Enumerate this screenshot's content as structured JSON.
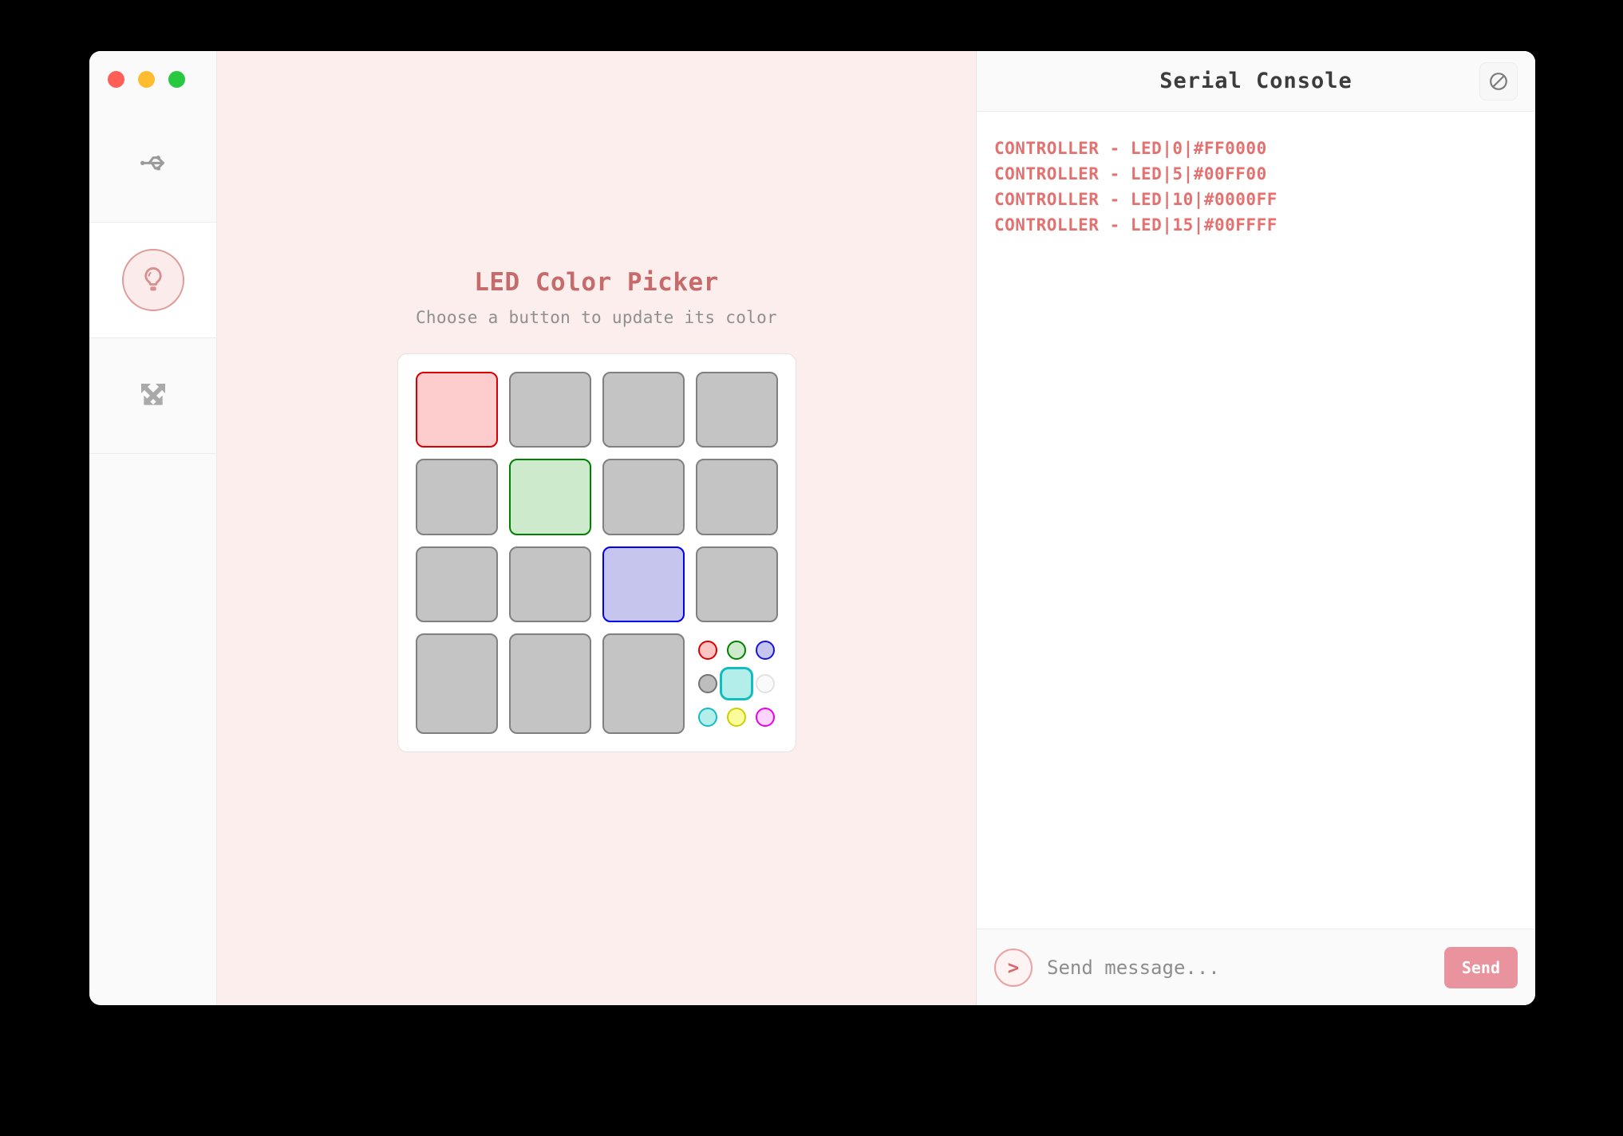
{
  "window": {
    "traffic_lights": [
      {
        "name": "close",
        "color": "#ff5f57"
      },
      {
        "name": "minimize",
        "color": "#febc2e"
      },
      {
        "name": "maximize",
        "color": "#28c840"
      }
    ]
  },
  "sidebar": {
    "items": [
      {
        "icon": "usb-icon",
        "active": false
      },
      {
        "icon": "lightbulb-icon",
        "active": true
      },
      {
        "icon": "expand-arrows-icon",
        "active": false
      }
    ]
  },
  "main": {
    "title": "LED Color Picker",
    "subtitle": "Choose a button to update its color",
    "title_color": "#c66b6b",
    "background": "#fbeeec",
    "led_grid": {
      "rows": 4,
      "cols": 4,
      "default_fill": "#c4c4c4",
      "default_border": "#808080",
      "buttons": [
        {
          "index": 0,
          "fill": "#fdcccc",
          "border": "#d80000",
          "color_name": "red"
        },
        {
          "index": 1,
          "fill": "#c4c4c4",
          "border": "#808080",
          "color_name": "off"
        },
        {
          "index": 2,
          "fill": "#c4c4c4",
          "border": "#808080",
          "color_name": "off"
        },
        {
          "index": 3,
          "fill": "#c4c4c4",
          "border": "#808080",
          "color_name": "off"
        },
        {
          "index": 4,
          "fill": "#c4c4c4",
          "border": "#808080",
          "color_name": "off"
        },
        {
          "index": 5,
          "fill": "#cdeacd",
          "border": "#008000",
          "color_name": "green"
        },
        {
          "index": 6,
          "fill": "#c4c4c4",
          "border": "#808080",
          "color_name": "off"
        },
        {
          "index": 7,
          "fill": "#c4c4c4",
          "border": "#808080",
          "color_name": "off"
        },
        {
          "index": 8,
          "fill": "#c4c4c4",
          "border": "#808080",
          "color_name": "off"
        },
        {
          "index": 9,
          "fill": "#c4c4c4",
          "border": "#808080",
          "color_name": "off"
        },
        {
          "index": 10,
          "fill": "#c5c5ee",
          "border": "#0000ee",
          "color_name": "blue"
        },
        {
          "index": 11,
          "fill": "#c4c4c4",
          "border": "#808080",
          "color_name": "off"
        },
        {
          "index": 12,
          "fill": "#c4c4c4",
          "border": "#808080",
          "color_name": "off"
        },
        {
          "index": 13,
          "fill": "#c4c4c4",
          "border": "#808080",
          "color_name": "off"
        },
        {
          "index": 14,
          "fill": "#c4c4c4",
          "border": "#808080",
          "color_name": "off"
        }
      ]
    },
    "palette": {
      "selected": "cyan",
      "swatches": [
        {
          "name": "red",
          "fill": "#fdc4c4",
          "border": "#dd0000",
          "selected": false
        },
        {
          "name": "green",
          "fill": "#cdeacd",
          "border": "#008000",
          "selected": false
        },
        {
          "name": "blue",
          "fill": "#c5c5ee",
          "border": "#1414e0",
          "selected": false
        },
        {
          "name": "gray",
          "fill": "#bdbdbd",
          "border": "#737373",
          "selected": false
        },
        {
          "name": "cyan",
          "fill": "#b4eeea",
          "border": "#12bdc0",
          "selected": true
        },
        {
          "name": "white",
          "fill": "#fafafa",
          "border": "#e2e2e2",
          "selected": false
        },
        {
          "name": "cyan-2",
          "fill": "#b4eeea",
          "border": "#12bdc0",
          "selected": false
        },
        {
          "name": "yellow",
          "fill": "#fbfb9c",
          "border": "#cfcf00",
          "selected": false
        },
        {
          "name": "magenta",
          "fill": "#fcd4fc",
          "border": "#e800e8",
          "selected": false
        }
      ]
    }
  },
  "console": {
    "title": "Serial Console",
    "clear_icon": "no-entry-icon",
    "log_color": "#e2716f",
    "lines": [
      "CONTROLLER - LED|0|#FF0000",
      "CONTROLLER - LED|5|#00FF00",
      "CONTROLLER - LED|10|#0000FF",
      "CONTROLLER - LED|15|#00FFFF"
    ],
    "input": {
      "value": "",
      "placeholder": "Send message...",
      "prompt_glyph": ">",
      "send_label": "Send",
      "send_color": "#e8939e"
    }
  }
}
